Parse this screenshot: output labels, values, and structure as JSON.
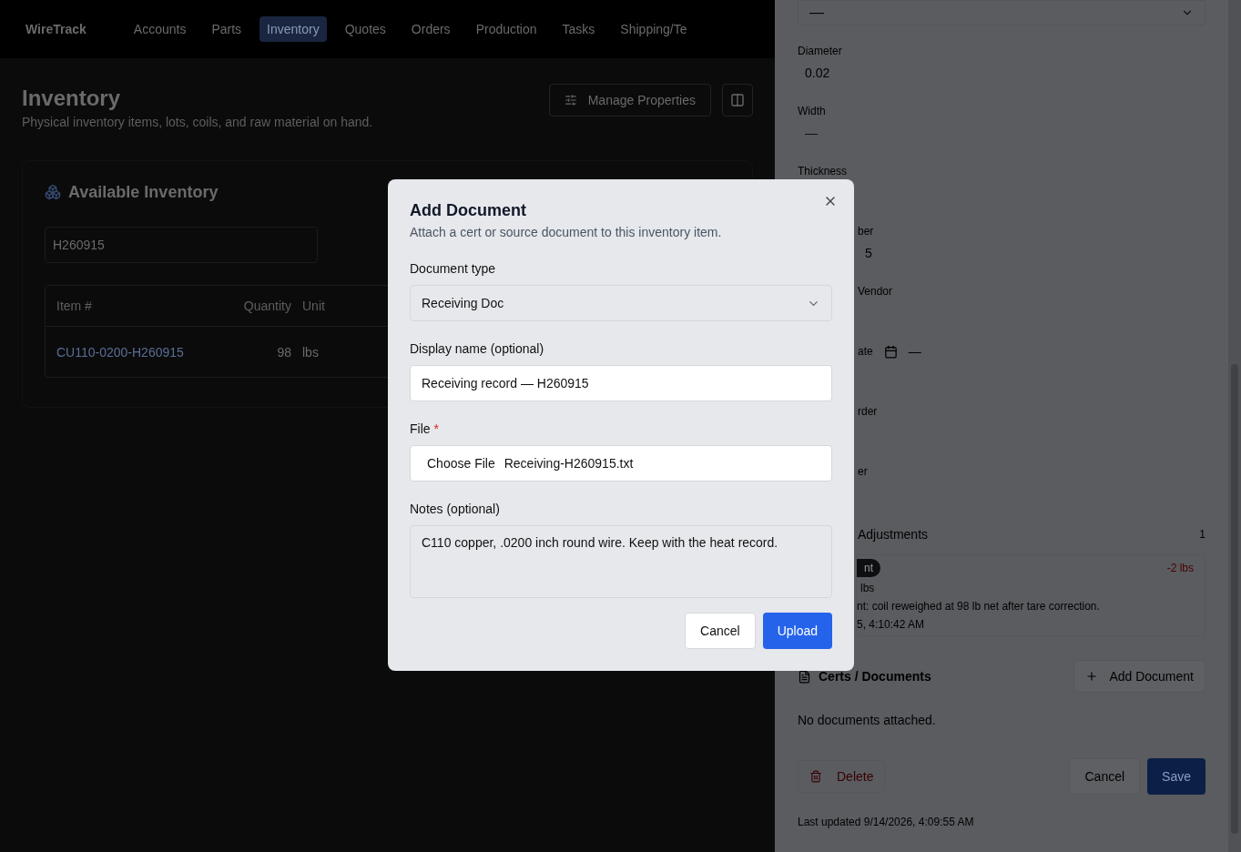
{
  "nav": {
    "logo": "WireTrack",
    "items": [
      {
        "label": "Accounts",
        "selected": false
      },
      {
        "label": "Parts",
        "selected": false
      },
      {
        "label": "Inventory",
        "selected": true
      },
      {
        "label": "Quotes",
        "selected": false
      },
      {
        "label": "Orders",
        "selected": false
      },
      {
        "label": "Production",
        "selected": false
      },
      {
        "label": "Tasks",
        "selected": false
      },
      {
        "label": "Shipping/Te",
        "selected": false
      }
    ]
  },
  "page": {
    "title": "Inventory",
    "subtitle": "Physical inventory items, lots, coils, and raw material on hand.",
    "manage_button": "Manage Properties"
  },
  "inventory_card": {
    "title": "Available Inventory",
    "search": {
      "value": "H260915"
    },
    "columns": [
      "Item #",
      "Quantity",
      "Unit"
    ],
    "rows": [
      {
        "item": "CU110-0200-H260915",
        "quantity": "98",
        "unit": "lbs"
      }
    ]
  },
  "side_panel": {
    "top_select": {
      "value": "—"
    },
    "fields": [
      {
        "label": "Diameter",
        "value": "0.02",
        "kind": "text"
      },
      {
        "label": "Width",
        "value": "—",
        "kind": "placeholder"
      },
      {
        "label": "Thickness",
        "kind": "text"
      },
      {
        "label": "ber",
        "value": "5",
        "kind": "text"
      },
      {
        "label": "Vendor",
        "kind": "text"
      },
      {
        "label": "ate",
        "value": "—",
        "kind": "date"
      },
      {
        "label": "rder",
        "kind": "text"
      },
      {
        "label": "er",
        "kind": "text"
      }
    ],
    "adjustments": {
      "title": "Adjustments",
      "count": "1",
      "entries": [
        {
          "badge": "nt",
          "delta": "-2 lbs",
          "amount": "lbs",
          "note": "nt: coil reweighed at 98 lb net after tare correction.",
          "time": "5, 4:10:42 AM"
        }
      ]
    },
    "documents": {
      "title": "Certs / Documents",
      "add_button": "Add Document",
      "empty": "No documents attached."
    },
    "delete_button": "Delete",
    "cancel_button": "Cancel",
    "save_button": "Save",
    "last_updated": "Last updated 9/14/2026, 4:09:55 AM"
  },
  "dialog": {
    "title": "Add Document",
    "description": "Attach a cert or source document to this inventory item.",
    "doc_type": {
      "label": "Document type",
      "value": "Receiving Doc"
    },
    "display_name": {
      "label": "Display name (optional)",
      "value": "Receiving record — H260915"
    },
    "file": {
      "label": "File",
      "required_mark": "*",
      "button": "Choose File",
      "filename": "Receiving-H260915.txt"
    },
    "notes": {
      "label": "Notes (optional)",
      "value": "C110 copper, .0200 inch round wire. Keep with the heat record."
    },
    "cancel_button": "Cancel",
    "upload_button": "Upload"
  }
}
